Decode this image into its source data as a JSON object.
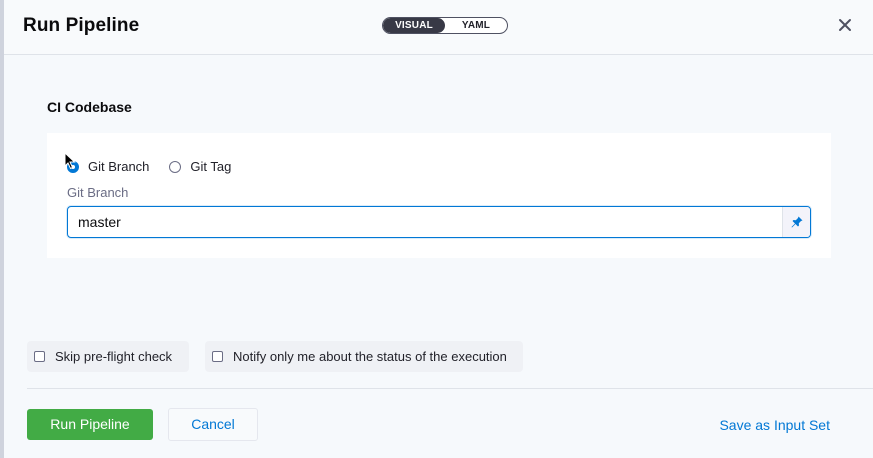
{
  "header": {
    "title": "Run Pipeline",
    "view_toggle": {
      "options": [
        "VISUAL",
        "YAML"
      ],
      "selected": "VISUAL"
    }
  },
  "codebase": {
    "section_title": "CI Codebase",
    "build_type_options": [
      {
        "label": "Git Branch",
        "checked": true
      },
      {
        "label": "Git Tag",
        "checked": false
      }
    ],
    "field_label": "Git Branch",
    "field_value": "master"
  },
  "options": {
    "skip_preflight": {
      "label": "Skip pre-flight check",
      "checked": false
    },
    "notify_only_me": {
      "label": "Notify only me about the status of the execution",
      "checked": false
    }
  },
  "footer": {
    "run_label": "Run Pipeline",
    "cancel_label": "Cancel",
    "save_input_set_label": "Save as Input Set"
  },
  "icons": {
    "close": "close-icon",
    "pin": "pin-icon"
  },
  "colors": {
    "accent": "#0278d5",
    "primary_button": "#42ab45",
    "toggle_active": "#383946"
  }
}
